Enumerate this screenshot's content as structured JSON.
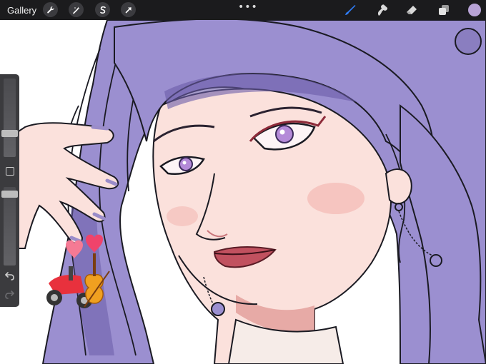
{
  "topbar": {
    "gallery_label": "Gallery",
    "left_tools": [
      {
        "name": "actions",
        "icon": "wrench-icon"
      },
      {
        "name": "adjustments",
        "icon": "magic-wand-icon"
      },
      {
        "name": "selection",
        "icon": "selection-s-icon"
      },
      {
        "name": "transform",
        "icon": "arrow-cursor-icon"
      }
    ],
    "more_label": "•••",
    "right_tools": [
      {
        "name": "brush",
        "icon": "brush-icon",
        "active": true
      },
      {
        "name": "smudge",
        "icon": "smudge-icon",
        "active": false
      },
      {
        "name": "eraser",
        "icon": "eraser-icon",
        "active": false
      },
      {
        "name": "layers",
        "icon": "layers-icon",
        "active": false
      }
    ],
    "current_color": "#b8a3d6",
    "accent_color": "#2f7cf6"
  },
  "sidebar": {
    "brush_size_level": 0.12,
    "opacity_level": 0.95,
    "modify_icon": "square-outline-icon",
    "undo_icon": "undo-icon",
    "redo_icon": "redo-icon"
  },
  "artwork": {
    "subject": "illustration",
    "palette": {
      "hair": "#9b8fd0",
      "hair_shadow": "#6a5ca8",
      "skin": "#fbe1dc",
      "skin_shadow": "#e7aaa6",
      "lips": "#c1515f",
      "line": "#1a1a22"
    },
    "stickers": [
      "heart-icon",
      "heart-icon",
      "scooter-icon",
      "violin-icon"
    ]
  }
}
